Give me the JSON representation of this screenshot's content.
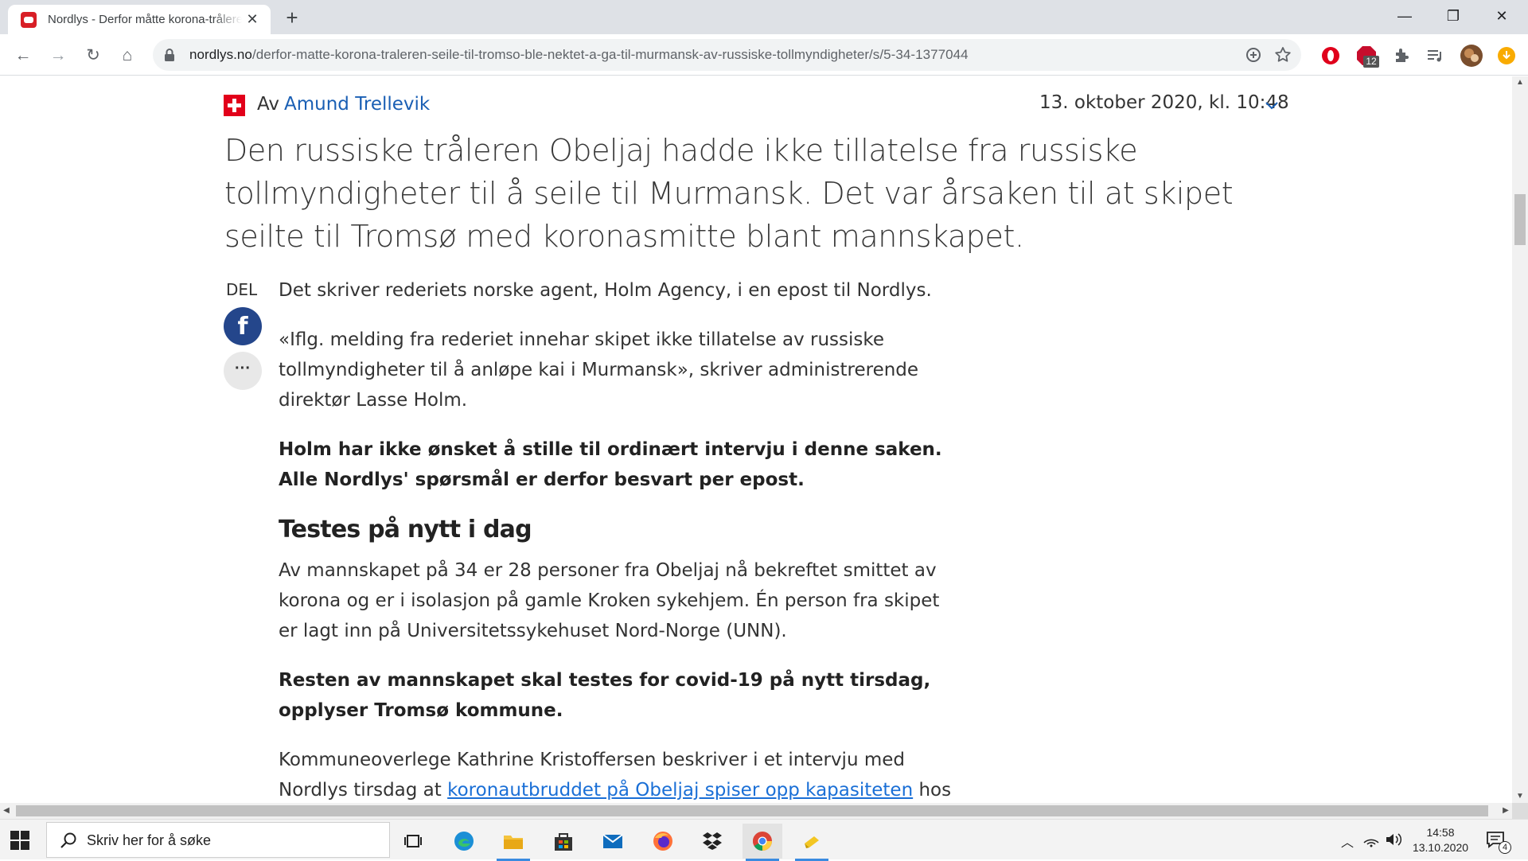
{
  "browser": {
    "tab": {
      "title": "Nordlys - Derfor måtte korona-tråleren seile til Tromsø",
      "close": "✕"
    },
    "new_tab": "+",
    "window": {
      "minimize": "—",
      "restore": "❐",
      "close": "✕"
    },
    "nav": {
      "back": "←",
      "forward": "→",
      "reload": "↻",
      "home": "⌂"
    },
    "url": {
      "domain": "nordlys.no",
      "path": "/derfor-matte-korona-traleren-seile-til-tromso-ble-nektet-a-ga-til-murmansk-av-russiske-tollmyndigheter/s/5-34-1377044"
    },
    "omnibox_icons": [
      "add-icon",
      "bookmark-star-icon"
    ],
    "extensions": {
      "opera_icon": "opera-extension-icon",
      "abp_badge": "12",
      "puzzle": "extensions-icon",
      "media": "media-control-icon",
      "profile": "profile-avatar",
      "update": "update-icon"
    }
  },
  "article": {
    "byline_prefix": "Av",
    "author": "Amund Trellevik",
    "date": "13. oktober 2020, kl. 10:48",
    "lead": "Den russiske tråleren Obeljaj hadde ikke tillatelse fra russiske tollmyndigheter til å seile til Murmansk. Det var årsaken til at skipet seilte til Tromsø med koronasmitte blant mannskapet.",
    "share": {
      "label": "DEL",
      "facebook": "f",
      "more": "···"
    },
    "p1": "Det skriver rederiets norske agent, Holm Agency, i en epost til Nordlys.",
    "p2": "«Iflg. melding fra rederiet innehar skipet ikke tillatelse av russiske tollmyndigheter til å anløpe kai i Murmansk», skriver administrerende direktør Lasse Holm.",
    "p3": "Holm har ikke ønsket å stille til ordinært intervju i denne saken. Alle Nordlys' spørsmål er derfor besvart per epost.",
    "h2": "Testes på nytt i dag",
    "p4": "Av mannskapet på 34 er 28 personer fra Obeljaj nå bekreftet smittet av korona og er i isolasjon på gamle Kroken sykehjem. Én person fra skipet er lagt inn på Universitetssykehuset Nord-Norge (UNN).",
    "p5": "Resten av mannskapet skal testes for covid-19 på nytt tirsdag, opplyser Tromsø kommune.",
    "p6_before": "Kommuneoverlege Kathrine Kristoffersen beskriver i et intervju med Nordlys tirsdag at ",
    "p6_link": "koronautbruddet på Obeljaj spiser opp kapasiteten",
    "p6_after": " hos"
  },
  "taskbar": {
    "search_placeholder": "Skriv her for å søke",
    "time": "14:58",
    "date": "13.10.2020",
    "notifications": "4",
    "apps": [
      "task-view",
      "edge",
      "file-explorer",
      "store",
      "mail",
      "firefox",
      "dropbox",
      "chrome",
      "sticky-app"
    ]
  },
  "colors": {
    "accent_red": "#e2001a",
    "link_blue": "#1a5fb4",
    "facebook": "#24468b"
  }
}
